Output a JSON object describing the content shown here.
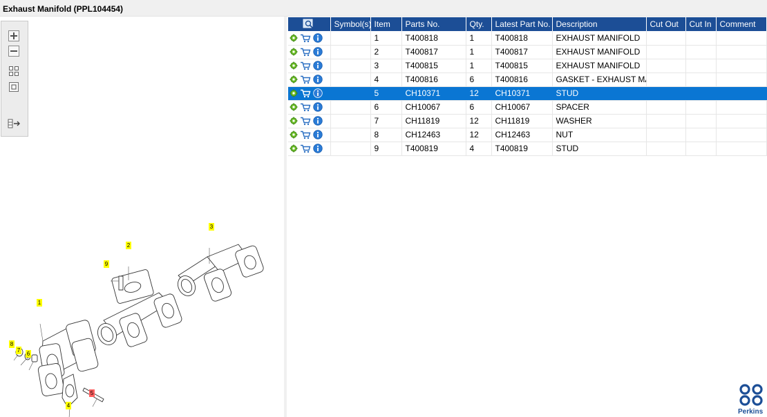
{
  "window": {
    "title": "Exhaust Manifold (PPL104454)"
  },
  "toolbar": {
    "buttons": [
      {
        "icon": "zoom-in-icon"
      },
      {
        "icon": "zoom-out-icon"
      },
      {
        "icon": "fit-all-icon"
      },
      {
        "icon": "actual-size-icon"
      },
      {
        "icon": "export-icon"
      }
    ]
  },
  "diagram": {
    "callouts": [
      "1",
      "2",
      "3",
      "4",
      "5",
      "6",
      "7",
      "8",
      "9"
    ],
    "highlighted_callout": "5",
    "highlight_color": "#ff6060",
    "callout_color": "#ffff00"
  },
  "table": {
    "header_color": "#1c4e96",
    "selected_color": "#0a76d3",
    "columns": [
      "Symbol(s)",
      "Item",
      "Parts No.",
      "Qty.",
      "Latest Part No.",
      "Description",
      "Cut Out",
      "Cut In",
      "Comment"
    ],
    "rows": [
      {
        "symbols": "",
        "item": "1",
        "part_no": "T400818",
        "qty": "1",
        "latest_part_no": "T400818",
        "description": "EXHAUST MANIFOLD",
        "cut_out": "",
        "cut_in": "",
        "comment": ""
      },
      {
        "symbols": "",
        "item": "2",
        "part_no": "T400817",
        "qty": "1",
        "latest_part_no": "T400817",
        "description": "EXHAUST MANIFOLD",
        "cut_out": "",
        "cut_in": "",
        "comment": ""
      },
      {
        "symbols": "",
        "item": "3",
        "part_no": "T400815",
        "qty": "1",
        "latest_part_no": "T400815",
        "description": "EXHAUST MANIFOLD",
        "cut_out": "",
        "cut_in": "",
        "comment": ""
      },
      {
        "symbols": "",
        "item": "4",
        "part_no": "T400816",
        "qty": "6",
        "latest_part_no": "T400816",
        "description": "GASKET - EXHAUST MANIF",
        "cut_out": "",
        "cut_in": "",
        "comment": ""
      },
      {
        "symbols": "",
        "item": "5",
        "part_no": "CH10371",
        "qty": "12",
        "latest_part_no": "CH10371",
        "description": "STUD",
        "cut_out": "",
        "cut_in": "",
        "comment": "",
        "selected": true
      },
      {
        "symbols": "",
        "item": "6",
        "part_no": "CH10067",
        "qty": "6",
        "latest_part_no": "CH10067",
        "description": "SPACER",
        "cut_out": "",
        "cut_in": "",
        "comment": ""
      },
      {
        "symbols": "",
        "item": "7",
        "part_no": "CH11819",
        "qty": "12",
        "latest_part_no": "CH11819",
        "description": "WASHER",
        "cut_out": "",
        "cut_in": "",
        "comment": ""
      },
      {
        "symbols": "",
        "item": "8",
        "part_no": "CH12463",
        "qty": "12",
        "latest_part_no": "CH12463",
        "description": "NUT",
        "cut_out": "",
        "cut_in": "",
        "comment": ""
      },
      {
        "symbols": "",
        "item": "9",
        "part_no": "T400819",
        "qty": "4",
        "latest_part_no": "T400819",
        "description": "STUD",
        "cut_out": "",
        "cut_in": "",
        "comment": ""
      }
    ],
    "row_icons": [
      "gear-icon",
      "cart-icon",
      "info-icon"
    ]
  },
  "brand": {
    "logo_text": "Perkins",
    "color": "#1c4e96"
  }
}
